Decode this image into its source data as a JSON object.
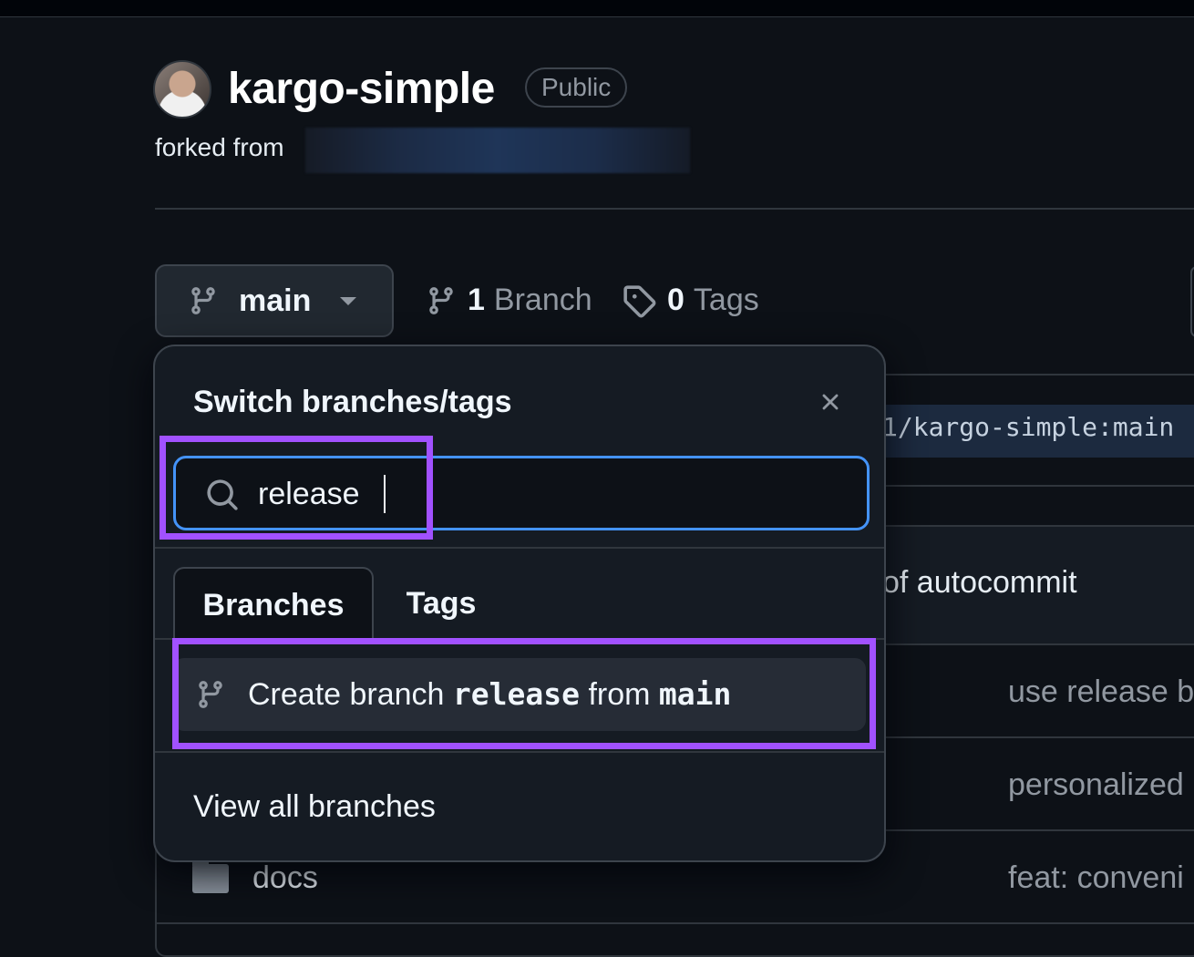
{
  "repo": {
    "name": "kargo-simple",
    "visibility": "Public",
    "forked_label": "forked from"
  },
  "branch_bar": {
    "current_branch": "main",
    "branch_count": "1",
    "branch_label": "Branch",
    "tag_count": "0",
    "tag_label": "Tags"
  },
  "background": {
    "compare_text": "1/kargo-simple:main",
    "commit_text": "of autocommit",
    "rows": [
      {
        "message": "use release b"
      },
      {
        "message": "personalized"
      },
      {
        "name": "docs",
        "message": "feat: conveni"
      }
    ]
  },
  "dropdown": {
    "title": "Switch branches/tags",
    "search_value": "release",
    "tabs": [
      "Branches",
      "Tags"
    ],
    "active_tab": "Branches",
    "create_item": {
      "prefix": "Create branch",
      "branch": "release",
      "middle": "from",
      "source": "main"
    },
    "footer_link": "View all branches"
  },
  "colors": {
    "accent_focus": "#4493f8",
    "highlight": "#a151ff",
    "background": "#0d1117"
  },
  "icons": [
    "git-branch-icon",
    "tag-icon",
    "search-icon",
    "close-icon",
    "triangle-down-icon",
    "folder-icon"
  ]
}
